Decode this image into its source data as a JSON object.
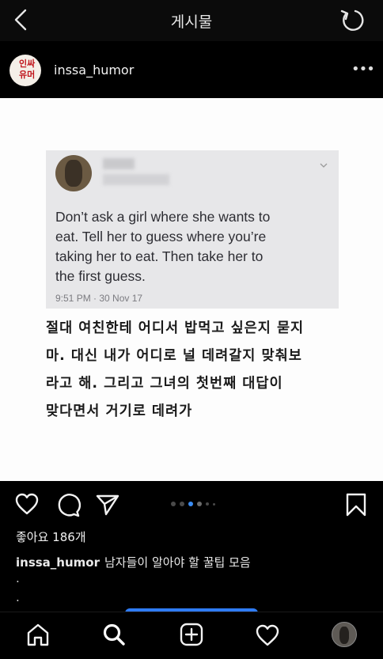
{
  "app": {
    "title": "게시물",
    "icons": {
      "back": "chevron-left-icon",
      "refresh": "refresh-icon"
    }
  },
  "post_header": {
    "username": "inssa_humor",
    "avatar_text": [
      "인싸",
      "유머"
    ],
    "more_label": "•••"
  },
  "post_image": {
    "tweet": {
      "text": "Don’t ask a girl where she wants to\neat. Tell her to guess where you’re\ntaking her to eat. Then take her to\nthe first guess.",
      "timestamp": "9:51 PM · 30 Nov 17"
    },
    "korean_text": "절대 여친한테 어디서 밥먹고 싶은지 묻지\n마. 대신 내가 어디로 널 데려갈지 맞춰보\n라고 해. 그리고 그녀의 첫번째 대답이\n맞다면서 거기로 데려가"
  },
  "actions": {
    "icons": [
      "heart-icon",
      "comment-icon",
      "share-icon",
      "bookmark-icon"
    ],
    "carousel_active_index": 2,
    "carousel_count": 6
  },
  "likes_text": "좋아요 186개",
  "caption": {
    "username": "inssa_humor",
    "text": "남자들이 알아야 할 꿀팁 모음"
  },
  "ellipsis": [
    ".",
    "."
  ],
  "bottom_nav": {
    "icons": [
      "home-icon",
      "search-icon",
      "add-post-icon",
      "activity-heart-icon",
      "profile-avatar"
    ]
  },
  "colors": {
    "accent": "#2f7cf6",
    "background": "#000000"
  }
}
